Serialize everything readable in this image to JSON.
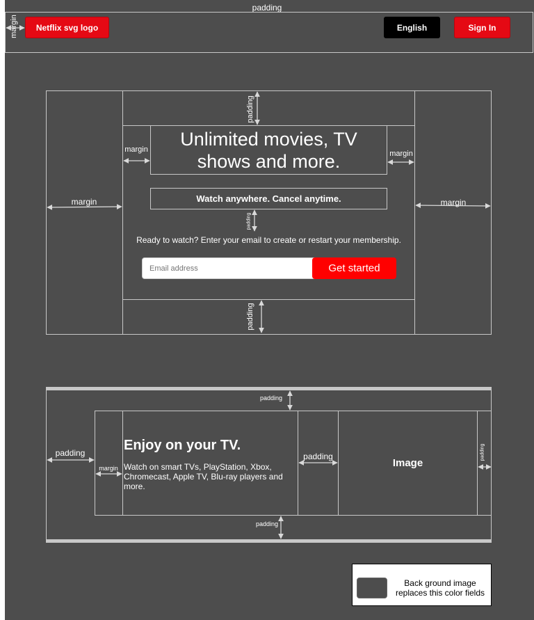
{
  "header": {
    "padding_label": "padding",
    "margin_label": "margin",
    "logo_label": "Netflix svg logo",
    "language_label": "English",
    "signin_label": "Sign In"
  },
  "hero": {
    "title": "Unlimited movies, TV shows and more.",
    "subtitle": "Watch anywhere. Cancel anytime.",
    "prompt": "Ready to watch? Enter your email to create or restart your membership.",
    "email_placeholder": "Email address",
    "cta_label": "Get started",
    "margin_label": "margin",
    "padding_label": "padding"
  },
  "feature": {
    "title": "Enjoy on your TV.",
    "body": "Watch on smart TVs, PlayStation, Xbox, Chromecast, Apple TV, Blu-ray players and more.",
    "image_label": "Image",
    "padding_label": "padding",
    "margin_label": "margin"
  },
  "legend": {
    "text": "Back ground image replaces this color fields"
  },
  "colors": {
    "background": "#4d4d4d",
    "accent_red": "#e50914",
    "guide_line": "#c8c8c8"
  }
}
